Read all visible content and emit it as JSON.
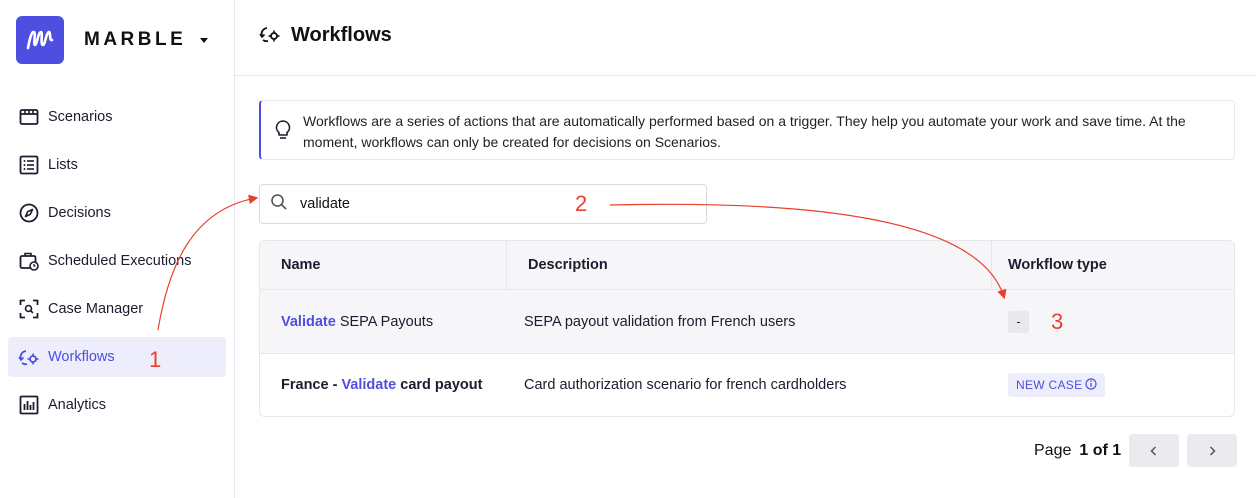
{
  "app": {
    "brand_name": "MARBLE"
  },
  "sidebar": {
    "items": [
      {
        "label": "Scenarios",
        "icon": "scenarios-icon"
      },
      {
        "label": "Lists",
        "icon": "lists-icon"
      },
      {
        "label": "Decisions",
        "icon": "compass-icon"
      },
      {
        "label": "Scheduled Executions",
        "icon": "scheduled-executions-icon"
      },
      {
        "label": "Case Manager",
        "icon": "case-manager-icon"
      },
      {
        "label": "Workflows",
        "icon": "workflows-icon",
        "active": true
      },
      {
        "label": "Analytics",
        "icon": "analytics-icon"
      }
    ]
  },
  "header": {
    "title": "Workflows"
  },
  "callout": {
    "text": "Workflows are a series of actions that are automatically performed based on a trigger. They help you automate your work and save time. At the moment, workflows can only be created for decisions on Scenarios."
  },
  "search": {
    "value": "validate"
  },
  "table": {
    "headers": [
      "Name",
      "Description",
      "Workflow type"
    ],
    "rows": [
      {
        "name_prefix": "",
        "name_highlight": "Validate",
        "name_suffix": " SEPA Payouts",
        "description": "SEPA payout validation from French users",
        "type": "-"
      },
      {
        "name_prefix": "France - ",
        "name_highlight": "Validate",
        "name_suffix": " card payout",
        "description": "Card authorization scenario for french cardholders",
        "type": "NEW CASE"
      }
    ]
  },
  "pagination": {
    "label": "Page",
    "value": "1 of 1"
  },
  "annotations": [
    "1",
    "2",
    "3"
  ],
  "colors": {
    "accent": "#4e4fe0",
    "annotation": "#e8402c"
  }
}
